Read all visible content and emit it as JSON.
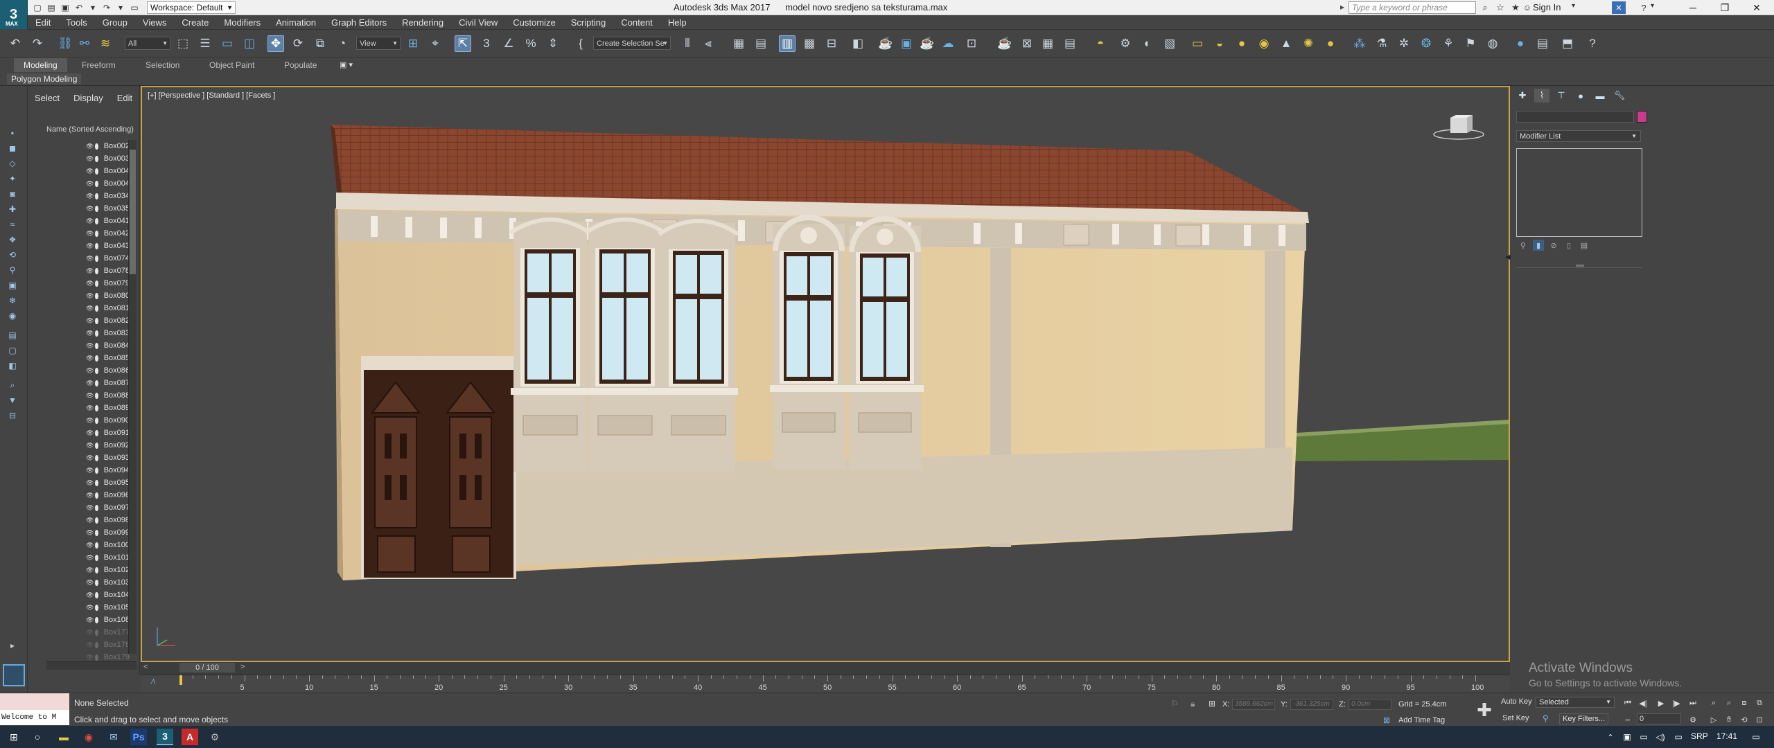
{
  "titlebar": {
    "logo_text": "3",
    "logo_sub": "MAX",
    "workspace_label": "Workspace: Default",
    "title": "Autodesk 3ds Max 2017      model novo sredjeno sa teksturama.max",
    "search_placeholder": "Type a keyword or phrase",
    "sign_in": "Sign In"
  },
  "menu": [
    "Edit",
    "Tools",
    "Group",
    "Views",
    "Create",
    "Modifiers",
    "Animation",
    "Graph Editors",
    "Rendering",
    "Civil View",
    "Customize",
    "Scripting",
    "Content",
    "Help"
  ],
  "toolbar": {
    "selection_filter": "All",
    "ref_coord": "View",
    "named_selection": "Create Selection Se"
  },
  "ribbon": {
    "tabs": [
      "Modeling",
      "Freeform",
      "Selection",
      "Object Paint",
      "Populate"
    ],
    "active_tab": "Modeling",
    "sub_label": "Polygon Modeling"
  },
  "explorer": {
    "tabs": [
      "Select",
      "Display",
      "Edit"
    ],
    "header": "Name (Sorted Ascending)",
    "items": [
      "Box002",
      "Box003",
      "Box004",
      "Box004",
      "Box034",
      "Box035",
      "Box041",
      "Box042",
      "Box043",
      "Box074",
      "Box078",
      "Box079",
      "Box080",
      "Box081",
      "Box082",
      "Box083",
      "Box084",
      "Box085",
      "Box086",
      "Box087",
      "Box088",
      "Box089",
      "Box090",
      "Box091",
      "Box092",
      "Box093",
      "Box094",
      "Box095",
      "Box096",
      "Box097",
      "Box098",
      "Box099",
      "Box100",
      "Box101",
      "Box102",
      "Box103",
      "Box104",
      "Box105",
      "Box108"
    ],
    "faded_items": [
      "Box177",
      "Box178",
      "Box179"
    ]
  },
  "viewport": {
    "label": "[+] [Perspective ] [Standard ] [Facets ]"
  },
  "timeslider": {
    "frame_label": "0 / 100",
    "current_frame": 0,
    "total_frames": 100,
    "ticks": [
      "5",
      "10",
      "15",
      "20",
      "25",
      "30",
      "35",
      "40",
      "45",
      "50",
      "55",
      "60",
      "65",
      "70",
      "75",
      "80",
      "85",
      "90",
      "95",
      "100"
    ]
  },
  "command_panel": {
    "modifier_list": "Modifier List",
    "object_color": "#cc3b8e"
  },
  "status": {
    "maxscript_text": "Welcome to M",
    "selection": "None Selected",
    "prompt": "Click and drag to select and move objects",
    "x_label": "X:",
    "x_value": "3589.662cm",
    "y_label": "Y:",
    "y_value": "-361.325cm",
    "z_label": "Z:",
    "z_value": "0.0cm",
    "grid": "Grid = 25.4cm",
    "add_time_tag": "Add Time Tag",
    "auto_key": "Auto Key",
    "set_key": "Set Key",
    "selected_dropdown": "Selected",
    "key_filters": "Key Filters...",
    "frame_value": "0"
  },
  "watermark": {
    "line1": "Activate Windows",
    "line2": "Go to Settings to activate Windows."
  },
  "taskbar": {
    "language": "SRP",
    "time": "17:41"
  },
  "colors": {
    "viewport_border": "#c8a341",
    "facade": "#e8cfa0",
    "trim": "#d6cbb9",
    "roof": "#8e4a32",
    "door": "#4a2a1e",
    "glass": "#cfe9f2"
  }
}
